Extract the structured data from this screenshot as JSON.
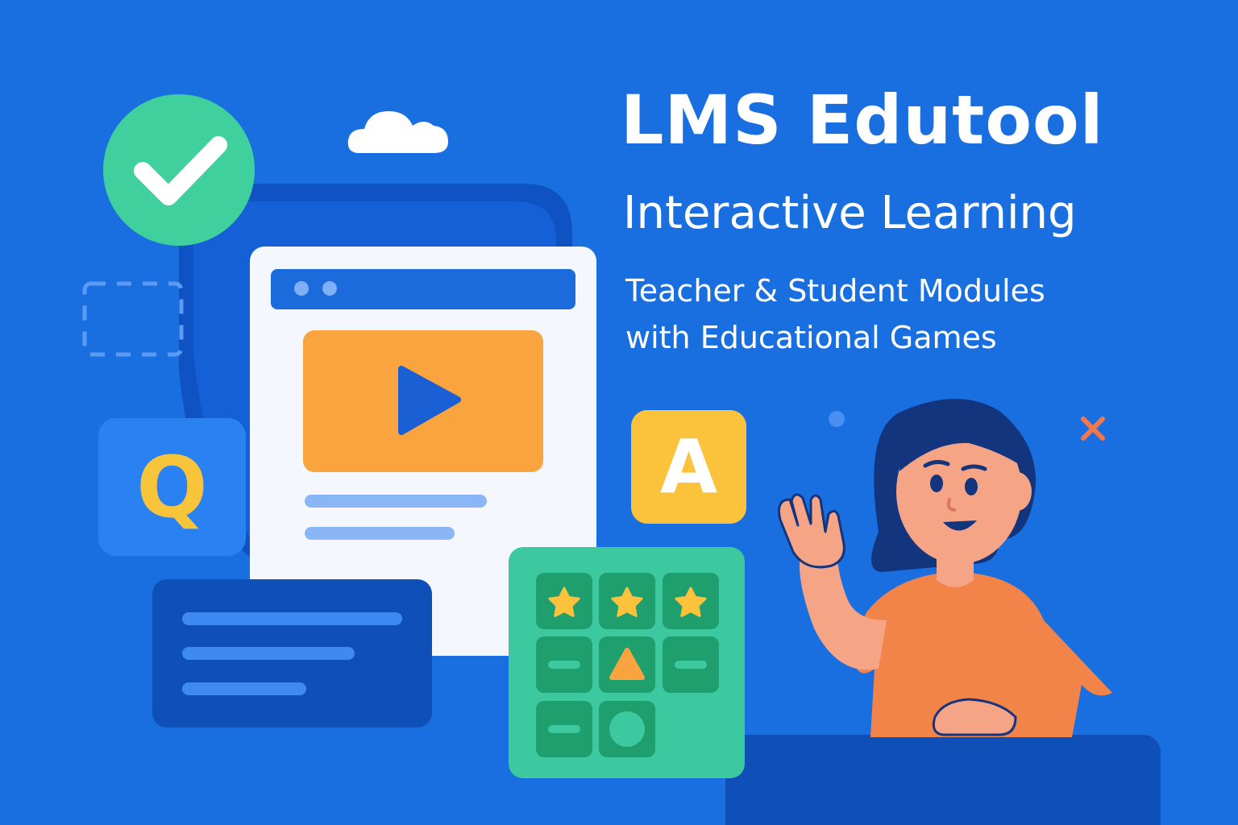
{
  "header": {
    "title": "LMS Edutool",
    "subtitle": "Interactive Learning",
    "tagline_lines": [
      "Teacher & Student Modules",
      "with Educational Games"
    ]
  },
  "tiles": {
    "q_letter": "Q",
    "a_letter": "A"
  },
  "icons": {
    "check": "check-badge-icon",
    "cloud": "cloud-icon",
    "play": "play-icon",
    "close": "close-x-icon",
    "star": "star-icon",
    "triangle": "triangle-icon",
    "circle": "circle-icon"
  },
  "game_board": {
    "cells": [
      "star",
      "star",
      "star",
      "dash",
      "triangle",
      "dash",
      "dash",
      "circle"
    ]
  },
  "colors": {
    "background": "#1a6fe0",
    "accent_orange": "#f9a43e",
    "accent_green": "#3cc9a0",
    "accent_yellow": "#fbc23c",
    "dark_blue": "#0f4fb8"
  }
}
